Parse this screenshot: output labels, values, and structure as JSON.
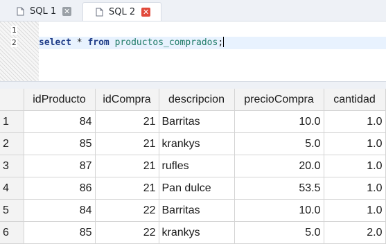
{
  "tabs": [
    {
      "label": "SQL 1",
      "close": "✕"
    },
    {
      "label": "SQL 2",
      "close": "✕"
    }
  ],
  "editor": {
    "line_numbers": [
      "1",
      "2"
    ],
    "query": {
      "kw1": "select",
      "star": " * ",
      "kw2": "from",
      "table": "productos_comprados",
      "end": ";"
    }
  },
  "results": {
    "columns": [
      "idProducto",
      "idCompra",
      "descripcion",
      "precioCompra",
      "cantidad"
    ],
    "rows": [
      {
        "n": "1",
        "idProducto": "84",
        "idCompra": "21",
        "descripcion": "Barritas",
        "precioCompra": "10.0",
        "cantidad": "1.0"
      },
      {
        "n": "2",
        "idProducto": "85",
        "idCompra": "21",
        "descripcion": "krankys",
        "precioCompra": "5.0",
        "cantidad": "1.0"
      },
      {
        "n": "3",
        "idProducto": "87",
        "idCompra": "21",
        "descripcion": "rufles",
        "precioCompra": "20.0",
        "cantidad": "1.0"
      },
      {
        "n": "4",
        "idProducto": "86",
        "idCompra": "21",
        "descripcion": "Pan dulce",
        "precioCompra": "53.5",
        "cantidad": "1.0"
      },
      {
        "n": "5",
        "idProducto": "84",
        "idCompra": "22",
        "descripcion": "Barritas",
        "precioCompra": "10.0",
        "cantidad": "1.0"
      },
      {
        "n": "6",
        "idProducto": "85",
        "idCompra": "22",
        "descripcion": "krankys",
        "precioCompra": "5.0",
        "cantidad": "2.0"
      }
    ]
  },
  "colors": {
    "keyword": "#1f3c88",
    "table_name": "#1d7a66",
    "close_active": "#e1493b"
  }
}
